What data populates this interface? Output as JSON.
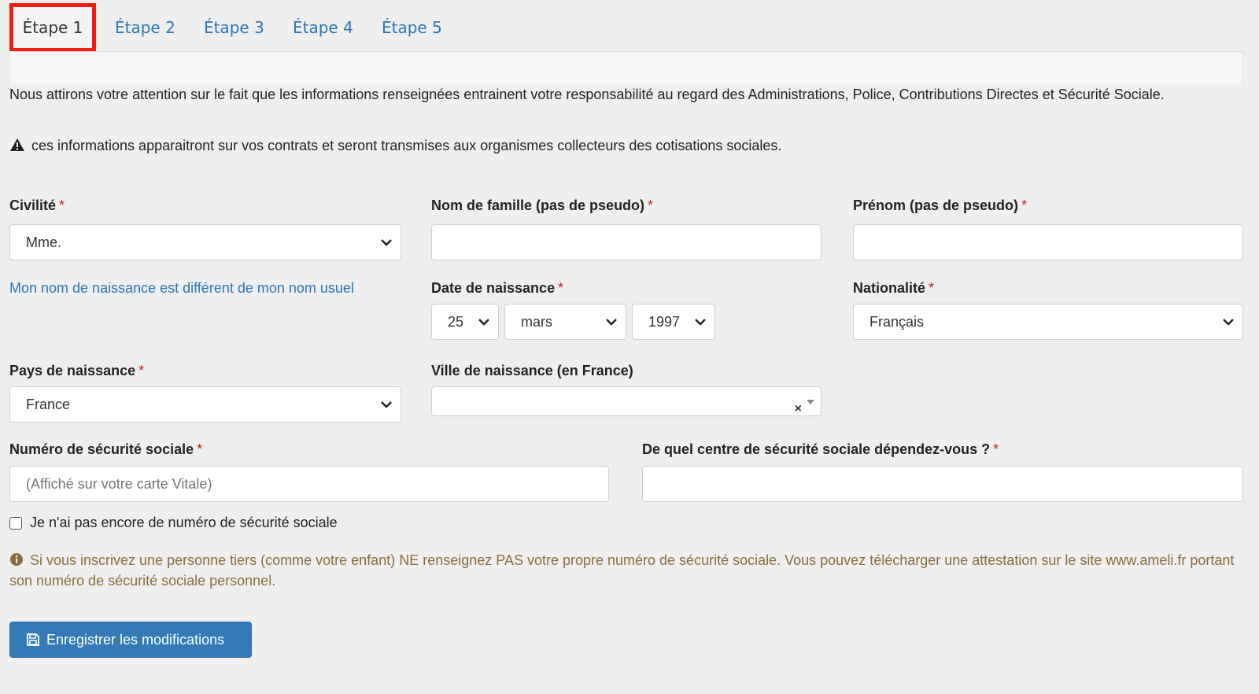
{
  "tabs": [
    {
      "label": "Étape 1"
    },
    {
      "label": "Étape 2"
    },
    {
      "label": "Étape 3"
    },
    {
      "label": "Étape 4"
    },
    {
      "label": "Étape 5"
    }
  ],
  "notice": {
    "text": "Nous attirons votre attention sur le fait que les informations renseignées entrainent votre responsabilité au regard des Administrations, Police, Contributions Directes et Sécurité Sociale.",
    "warning": "ces informations apparaitront sur vos contrats et seront transmises aux organismes collecteurs des cotisations sociales."
  },
  "form": {
    "required_mark": "*",
    "civilite": {
      "label": "Civilité",
      "value": "Mme."
    },
    "nom": {
      "label": "Nom de famille (pas de pseudo)",
      "value": ""
    },
    "prenom": {
      "label": "Prénom (pas de pseudo)",
      "value": ""
    },
    "birth_name_link": "Mon nom de naissance est différent de mon nom usuel",
    "date_naissance": {
      "label": "Date de naissance",
      "day": "25",
      "month": "mars",
      "year": "1997"
    },
    "nationalite": {
      "label": "Nationalité",
      "value": "Français"
    },
    "pays_naissance": {
      "label": "Pays de naissance",
      "value": "France"
    },
    "ville_naissance": {
      "label": "Ville de naissance (en France)",
      "value": "",
      "clear": "×"
    },
    "secu": {
      "label": "Numéro de sécurité sociale",
      "placeholder": "(Affiché sur votre carte Vitale)"
    },
    "centre_secu": {
      "label": "De quel centre de sécurité sociale dépendez-vous ?",
      "value": ""
    },
    "no_secu_checkbox": "Je n'ai pas encore de numéro de sécurité sociale",
    "info": "Si vous inscrivez une personne tiers (comme votre enfant) NE renseignez PAS votre propre numéro de sécurité sociale. Vous pouvez télécharger une attestation sur le site www.ameli.fr portant son numéro de sécurité sociale personnel.",
    "save_label": "Enregistrer les modifications"
  },
  "colors": {
    "accent": "#337ab7",
    "link": "#2a76b5",
    "active_tab_highlight": "#f01c10",
    "required": "#c31f1f",
    "info_text": "#8a6d3b"
  },
  "icons": {
    "warning": "warning-triangle-icon",
    "info": "info-circle-icon",
    "save": "floppy-disk-icon",
    "chevron": "chevron-down-icon"
  }
}
